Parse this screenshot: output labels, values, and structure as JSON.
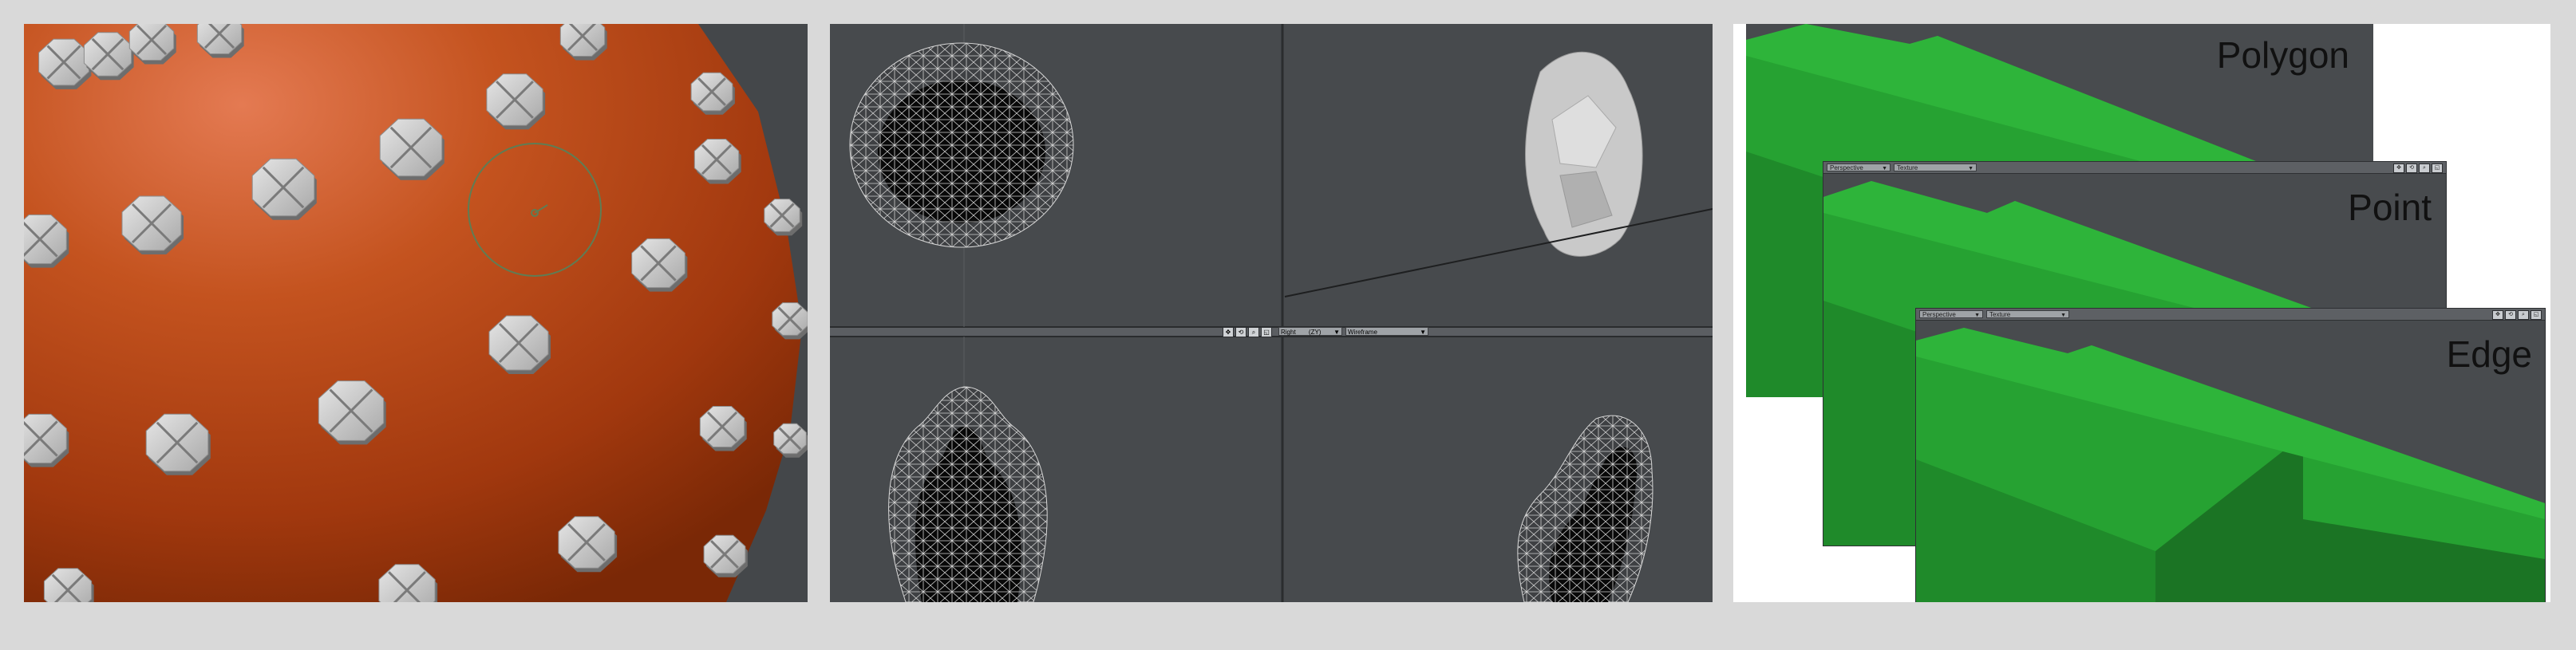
{
  "panels": {
    "modeler": {
      "colors": {
        "sphere": "#b9471b",
        "highlight": "#e47a52",
        "bolt": "#c8c8c8",
        "background": "#44474a"
      }
    },
    "quad": {
      "toolbar": {
        "view": "Right",
        "axis": "(ZY)",
        "render_mode": "Wireframe"
      },
      "colors": {
        "background": "#474a4d",
        "wire": "#d8d8d8",
        "divider": "#2a2c2e"
      }
    },
    "selection_modes": {
      "windows": [
        {
          "label": "Polygon"
        },
        {
          "label": "Point",
          "view_dropdown": "Perspective",
          "render_dropdown": "Texture"
        },
        {
          "label": "Edge",
          "view_dropdown": "Perspective",
          "render_dropdown": "Texture"
        }
      ],
      "colors": {
        "object": "#26a232",
        "object_dark": "#1b7424",
        "background": "#484b4e"
      }
    }
  }
}
